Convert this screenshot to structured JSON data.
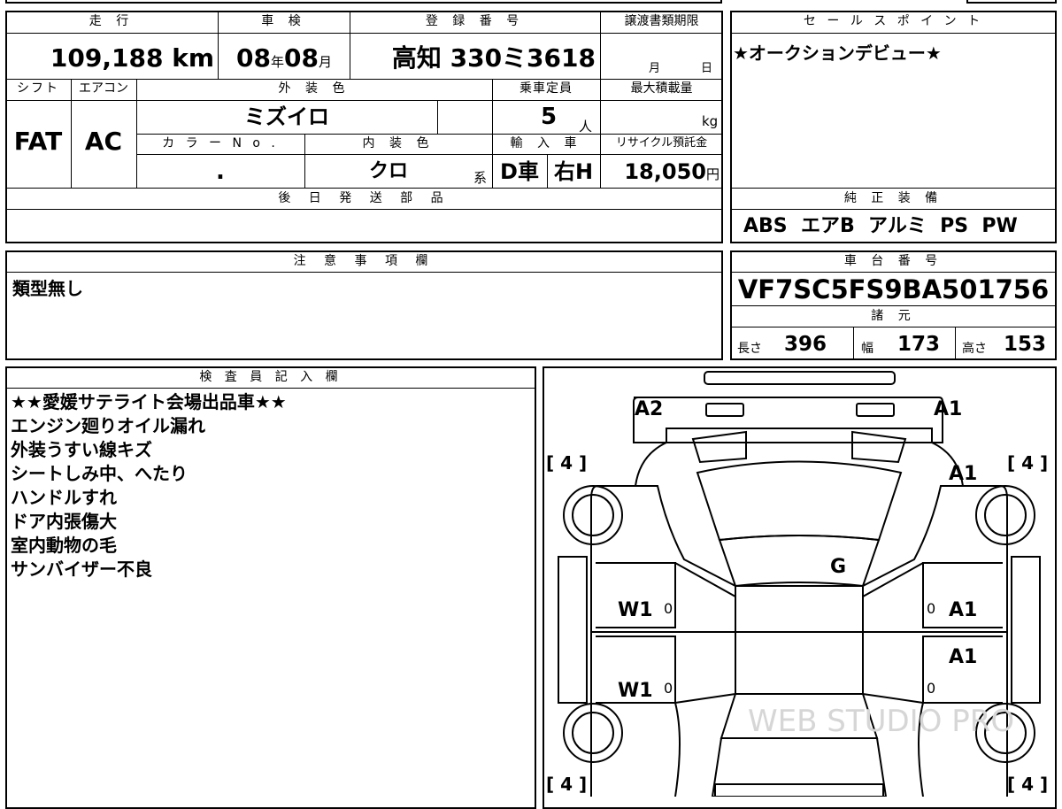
{
  "headers": {
    "mileage": "走 行",
    "inspection": "車 検",
    "registration": "登 録 番 号",
    "transfer_deadline": "譲渡書類期限",
    "shift": "シフト",
    "aircon": "エアコン",
    "exterior_color": "外 装 色",
    "capacity": "乗車定員",
    "max_load": "最大積載量",
    "color_no": "カ ラ ー N o .",
    "interior_color": "内 装 色",
    "import": "輸 入 車",
    "recycle": "リサイクル預託金",
    "later_parts": "後 日 発 送 部 品",
    "sales_point": "セ ー ル ス ポ イ ン ト",
    "genuine_equipment": "純 正 装 備",
    "caution": "注 意 事 項 欄",
    "chassis_no": "車 台 番 号",
    "specs": "諸 元",
    "inspector": "検 査 員 記 入 欄"
  },
  "vehicle": {
    "mileage_value": "109,188",
    "mileage_unit": "km",
    "inspection_year": "08",
    "year_unit": "年",
    "inspection_month": "08",
    "month_unit": "月",
    "registration_number": "高知 330ミ3618",
    "transfer_month_unit": "月",
    "transfer_day_unit": "日",
    "shift": "FAT",
    "aircon": "AC",
    "exterior_color": "ミズイロ",
    "capacity": "5",
    "capacity_unit": "人",
    "load_unit": "kg",
    "color_no": ".",
    "interior_color": "クロ",
    "interior_suffix": "系",
    "import_type": "D車",
    "steering": "右H",
    "recycle_fee": "18,050",
    "recycle_unit": "円"
  },
  "sales_point_text": "★オークションデビュー★",
  "genuine_equipment_text": "ABS  エアB  アルミ  PS  PW",
  "caution_text": "類型無し",
  "chassis_number": "VF7SC5FS9BA501756",
  "specs": {
    "length_label": "長さ",
    "length": "396",
    "width_label": "幅",
    "width": "173",
    "height_label": "高さ",
    "height": "153"
  },
  "inspector_notes": [
    "★★愛媛サテライト会場出品車★★",
    "エンジン廻りオイル漏れ",
    "外装うすい線キズ",
    "シートしみ中、へたり",
    "ハンドルすれ",
    "ドア内張傷大",
    "室内動物の毛",
    "サンバイザー不良"
  ],
  "diagram": {
    "marks": {
      "front_left": "A2",
      "front_right": "A1",
      "right_fender": "A1",
      "windshield": "G",
      "left_front_door": "W1",
      "left_rear_door": "W1",
      "right_front_door": "A1",
      "right_rear_door": "A1"
    },
    "tire_front_left": "[ 4 ]",
    "tire_front_right": "[ 4 ]",
    "tire_rear_left": "[ 4 ]",
    "tire_rear_right": "[ 4 ]",
    "door_zero": "0",
    "watermark": "WEB STUDIO PRO"
  }
}
